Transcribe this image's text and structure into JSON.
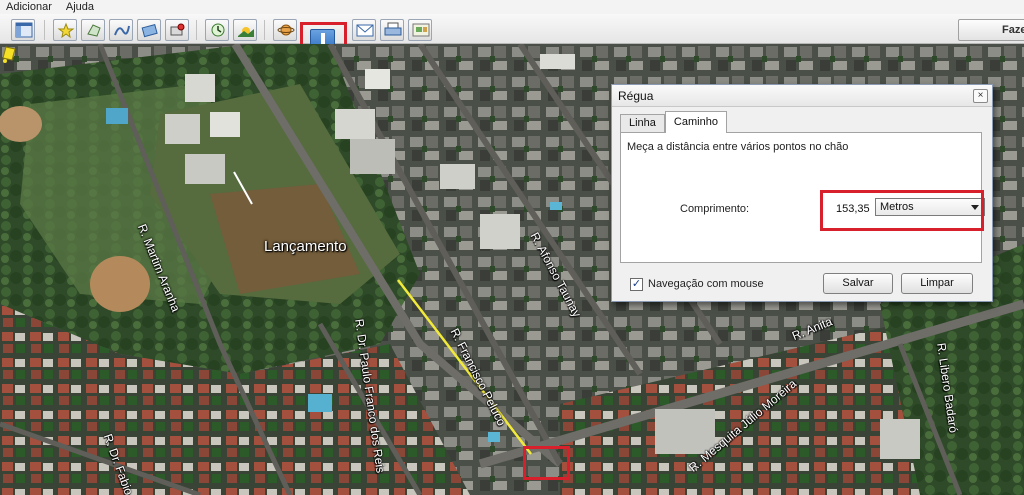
{
  "menu": {
    "items": [
      "Adicionar",
      "Ajuda"
    ]
  },
  "toolbar": {
    "tour_button_label": "Fazer",
    "icons": [
      "sidebar-toggle",
      "placemark",
      "polygon",
      "path",
      "image-overlay",
      "record-tour",
      "historical-imagery",
      "sun",
      "planets",
      "ruler",
      "email",
      "print",
      "view-in-maps"
    ]
  },
  "map": {
    "placemark_label": "Lançamento",
    "streets": [
      "R. Martim Aranha",
      "R. Afonso Taunay",
      "R. Francisco Peluco",
      "R. Dr. Paulo Franco dos Reis",
      "R. Anita",
      "R. Libero Badaró",
      "R. Dr. Fabio",
      "R. Mesquita Júlio Moreira"
    ]
  },
  "ruler_dialog": {
    "title": "Régua",
    "close_symbol": "×",
    "tabs": [
      {
        "label": "Linha",
        "active": false
      },
      {
        "label": "Caminho",
        "active": true
      }
    ],
    "description": "Meça a distância entre vários pontos no chão",
    "length_label": "Comprimento:",
    "length_value": "153,35",
    "unit_selected": "Metros",
    "mouse_nav_label": "Navegação com mouse",
    "mouse_nav_checked": true,
    "check_symbol": "✓",
    "save_label": "Salvar",
    "clear_label": "Limpar"
  },
  "colors": {
    "highlight_red": "#d8202c",
    "path_yellow": "#f2ea3a",
    "ruler_button_blue": "#2f6fc0"
  }
}
